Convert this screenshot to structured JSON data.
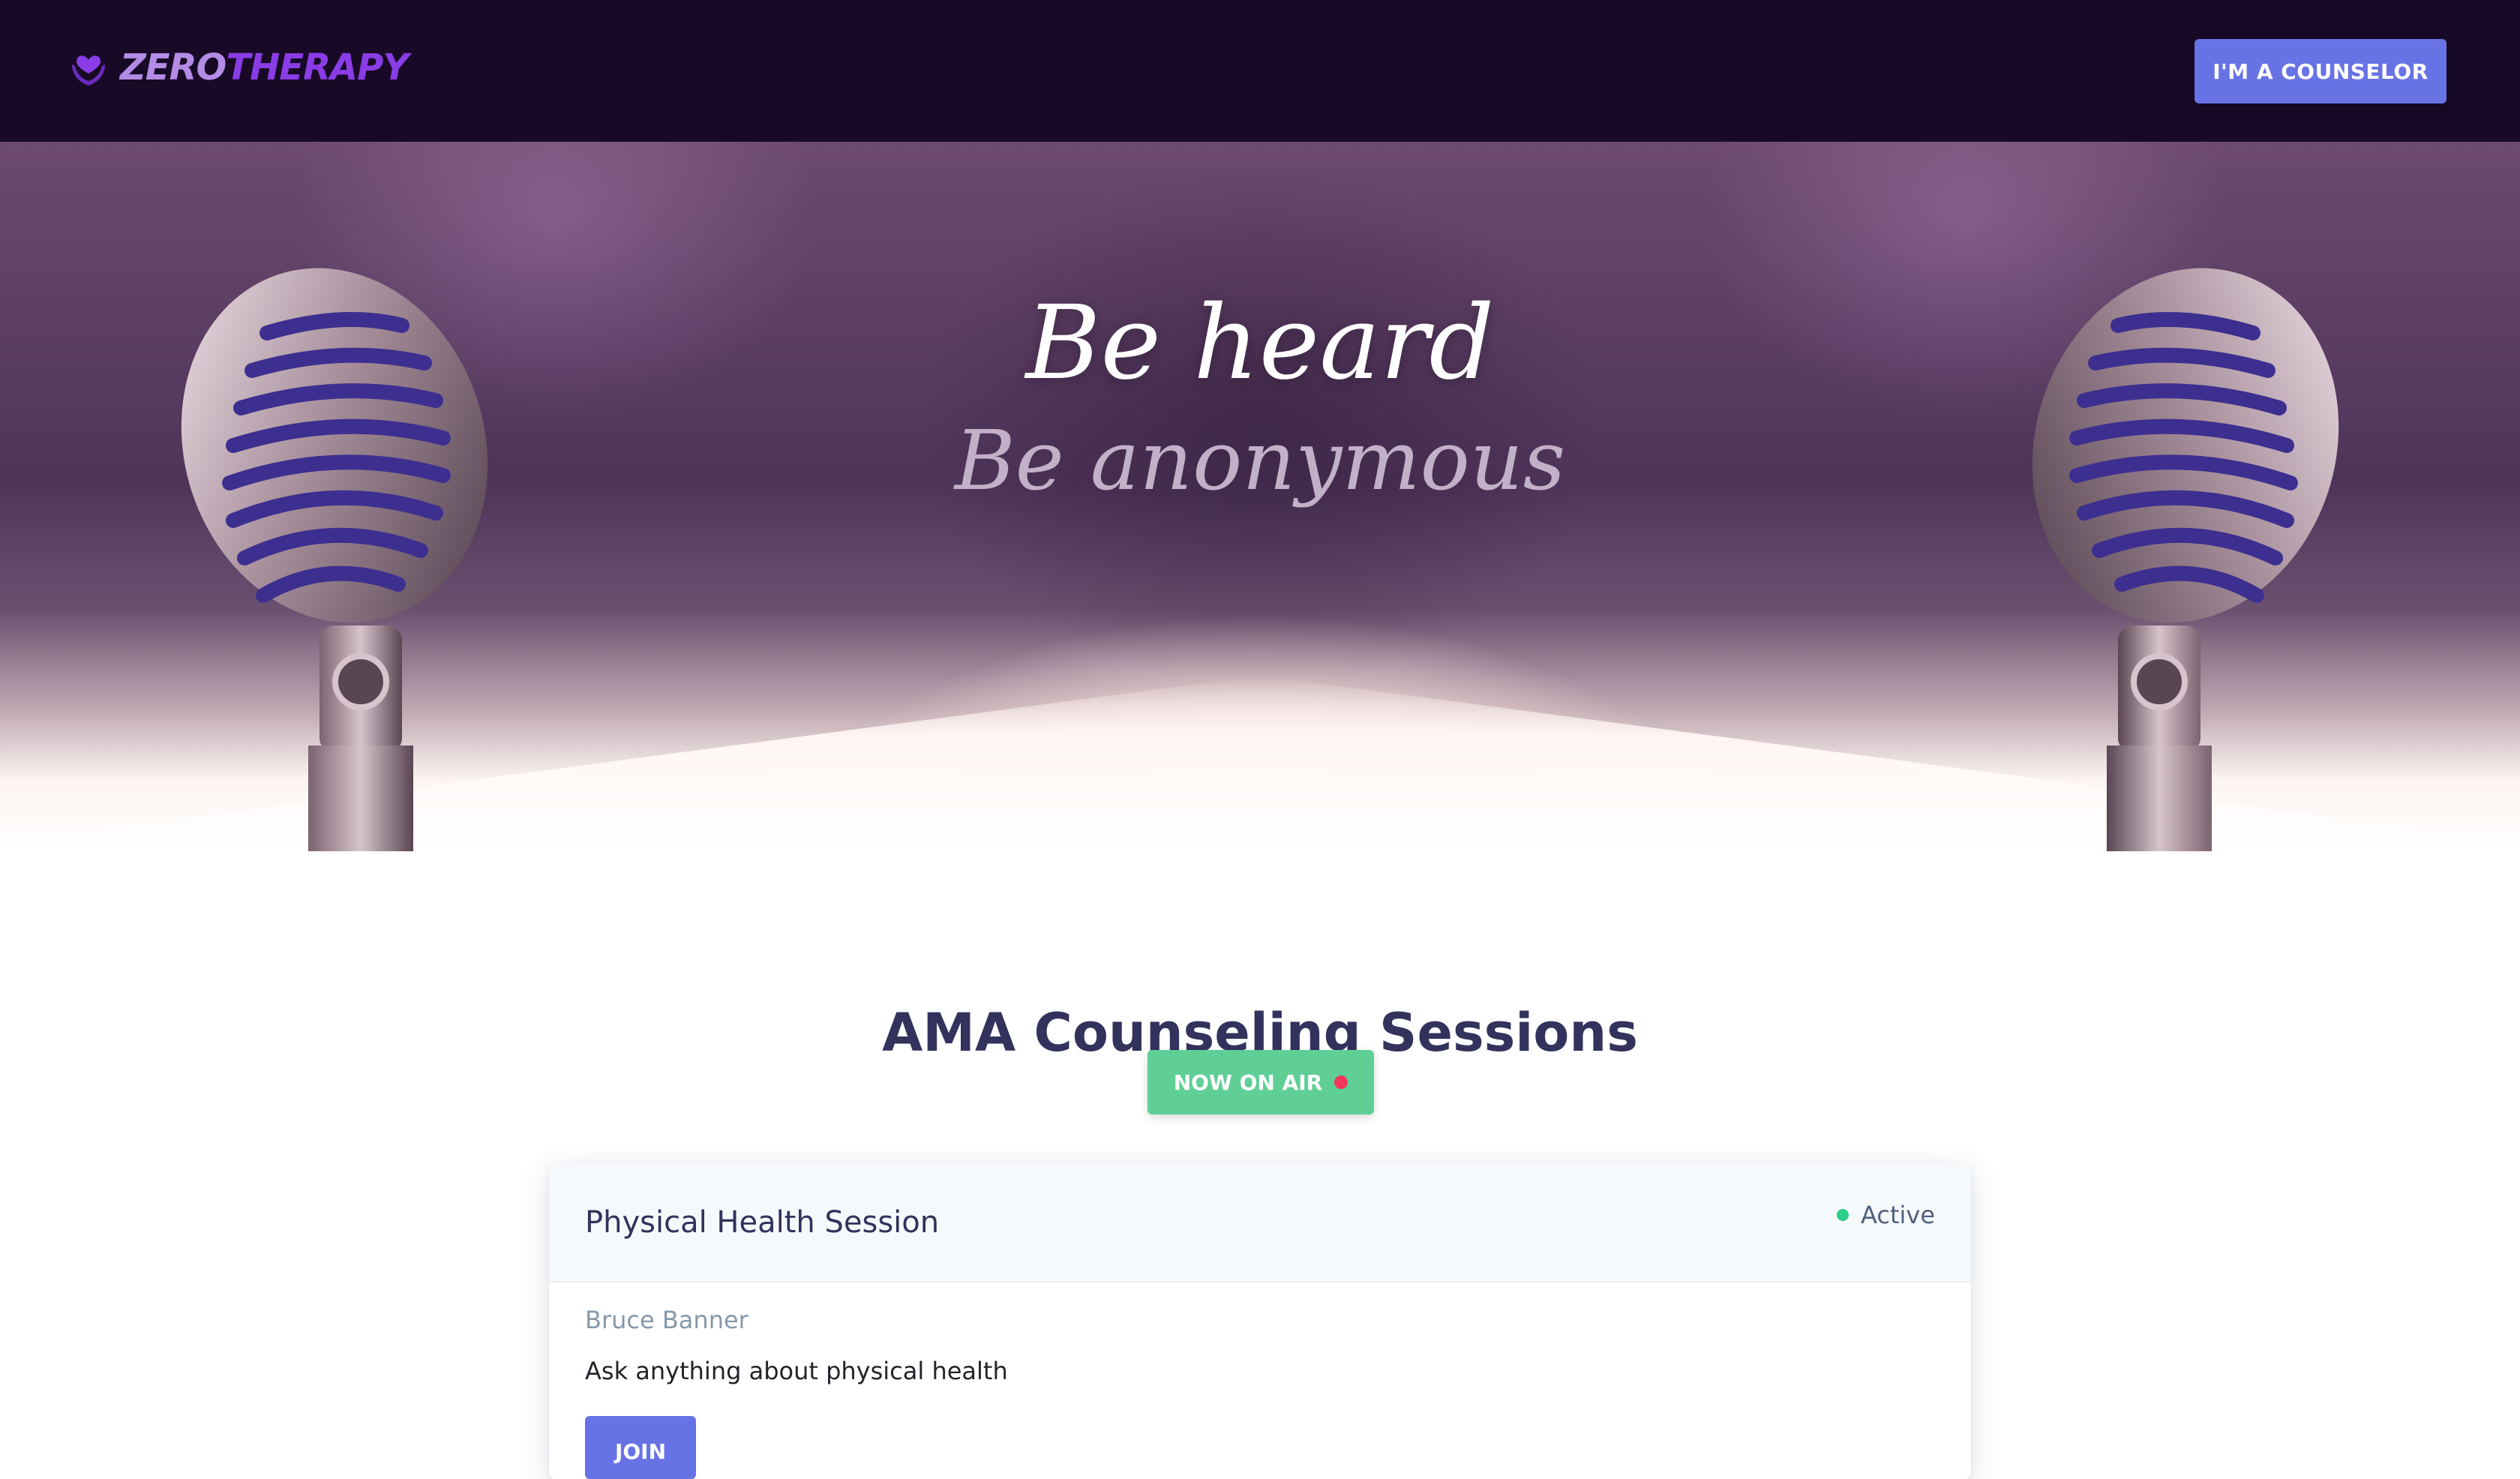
{
  "navbar": {
    "brand_zero": "ZERO",
    "brand_therapy": "THERAPY",
    "counselor_button": "I'M A COUNSELOR"
  },
  "hero": {
    "tagline_primary": "Be heard",
    "tagline_secondary": "Be anonymous"
  },
  "sessions": {
    "title": "AMA Counseling Sessions",
    "on_air_label": "NOW ON AIR",
    "items": [
      {
        "title": "Physical Health Session",
        "status": "Active",
        "host": "Bruce Banner",
        "description": "Ask anything about physical health",
        "join_label": "JOIN"
      }
    ]
  },
  "icons": {
    "brand_logo": "hands-heart-icon",
    "live_indicator": "red-dot-icon",
    "status_indicator": "green-dot-icon",
    "hero_decor": "microphone-icon"
  },
  "colors": {
    "navbar_bg": "#180a27",
    "primary": "#6772e5",
    "success": "#5fcf96",
    "live_red": "#f5365c",
    "active_green": "#2dce89",
    "heading": "#32325d"
  }
}
